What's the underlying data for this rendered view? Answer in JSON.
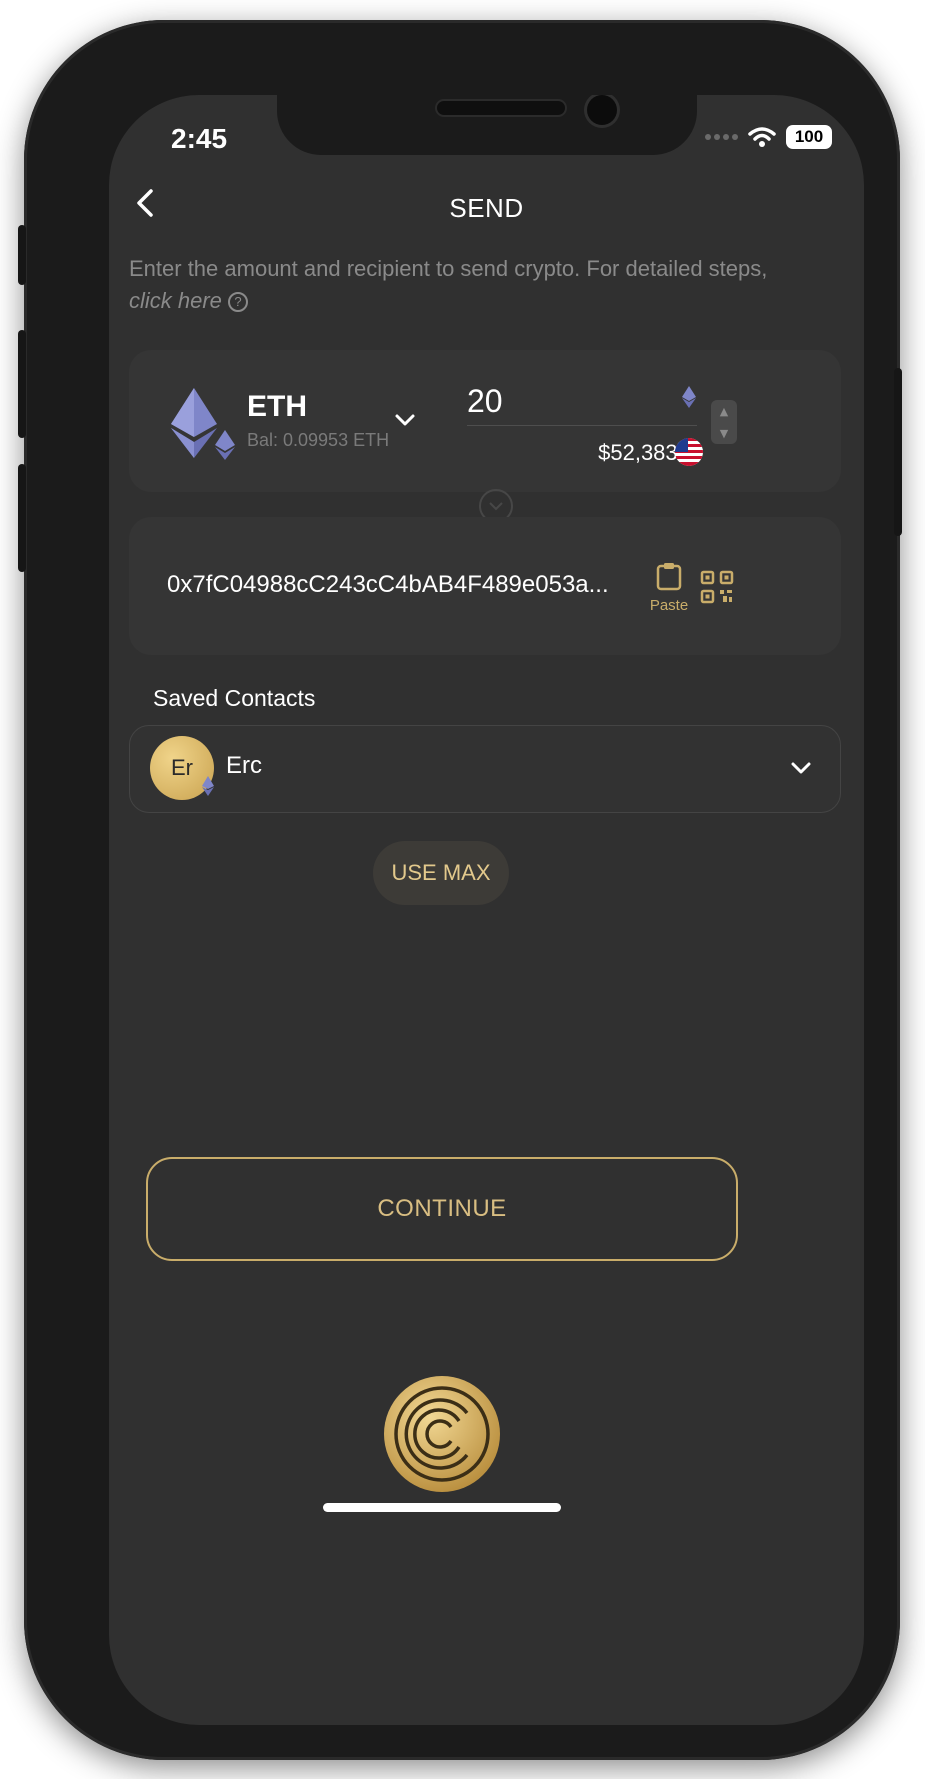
{
  "status_bar": {
    "time": "2:45",
    "battery": "100"
  },
  "header": {
    "title": "SEND"
  },
  "intro": {
    "text": "Enter the amount and recipient to send crypto. For detailed steps, ",
    "link": "click here",
    "help_symbol": "?"
  },
  "asset": {
    "symbol": "ETH",
    "balance": "Bal: 0.09953 ETH",
    "amount": "20",
    "fiat_value": "$52,383.2"
  },
  "recipient": {
    "address": "0x7fC04988cC243cC4bAB4F489e053a...",
    "paste_label": "Paste"
  },
  "saved_contacts": {
    "title": "Saved Contacts",
    "selected": {
      "initials": "Er",
      "name": "Erc"
    }
  },
  "actions": {
    "use_max": "USE MAX",
    "continue": "CONTINUE"
  },
  "colors": {
    "accent_gold": "#c9ad6a",
    "background": "#303030",
    "card": "#353535"
  }
}
